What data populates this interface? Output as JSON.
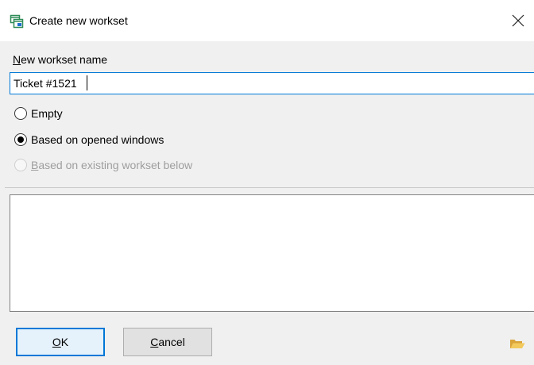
{
  "window": {
    "title": "Create new workset",
    "icon": "workset-window-icon",
    "close_icon": "close-icon"
  },
  "form": {
    "name_label_accesskey": "N",
    "name_label_rest": "ew workset name",
    "name_value": "Ticket #1521"
  },
  "options": {
    "empty": {
      "label": "Empty",
      "selected": false,
      "enabled": true
    },
    "opened_windows": {
      "label": "Based on opened windows",
      "selected": true,
      "enabled": true
    },
    "existing": {
      "accesskey": "B",
      "label_rest": "ased on existing workset below",
      "selected": false,
      "enabled": false
    }
  },
  "workset_list": {
    "items": []
  },
  "buttons": {
    "ok_accesskey": "O",
    "ok_rest": "K",
    "cancel_accesskey": "C",
    "cancel_rest": "ancel",
    "folder_icon": "folder-open-icon"
  },
  "colors": {
    "accent": "#0078d7",
    "folder": "#e8b84a",
    "icon_green": "#2e8b57",
    "icon_blue": "#1e6fcf"
  }
}
